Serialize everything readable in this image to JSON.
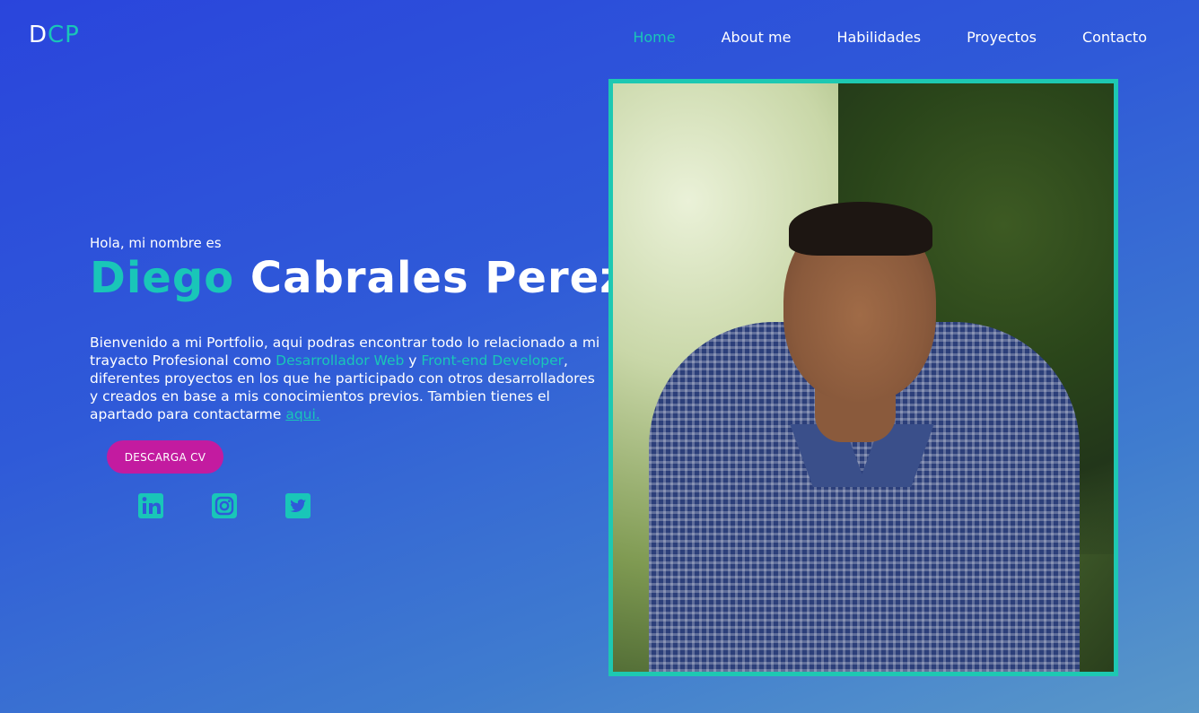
{
  "header": {
    "logo_first": "D",
    "logo_rest": "CP",
    "nav": [
      {
        "label": "Home",
        "active": true
      },
      {
        "label": "About me",
        "active": false
      },
      {
        "label": "Habilidades",
        "active": false
      },
      {
        "label": "Proyectos",
        "active": false
      },
      {
        "label": "Contacto",
        "active": false
      }
    ]
  },
  "hero": {
    "greeting": "Hola, mi nombre es",
    "first_name": "Diego",
    "last_name": "Cabrales Perez",
    "desc_part1": "Bienvenido a mi Portfolio, aqui podras encontrar todo lo relacionado a mi trayacto Profesional como ",
    "highlight1": "Desarrollador Web",
    "desc_and": " y ",
    "highlight2": "Front-end Developer",
    "desc_part2": ", diferentes proyectos en los que he participado con otros desarrolladores y creados en base a mis conocimientos previos. Tambien tienes el apartado para contactarme ",
    "contact_link": "aqui.",
    "cv_button": "DESCARGA CV"
  },
  "social": [
    {
      "icon": "linkedin-icon"
    },
    {
      "icon": "instagram-icon"
    },
    {
      "icon": "twitter-icon"
    }
  ],
  "colors": {
    "accent": "#19c6b8",
    "button": "#c31ba0",
    "frame": "#1ec8b2"
  }
}
